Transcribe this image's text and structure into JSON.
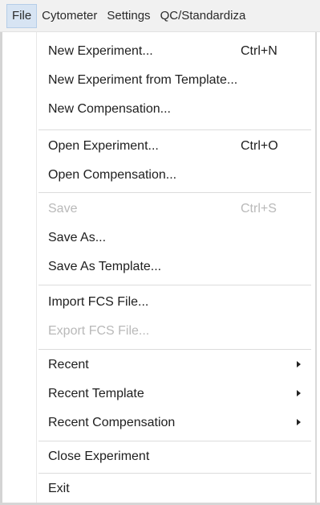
{
  "menubar": {
    "items": [
      "File",
      "Cytometer",
      "Settings",
      "QC/Standardiza"
    ]
  },
  "file_menu": {
    "items": [
      {
        "label": "New Experiment...",
        "shortcut": "Ctrl+N",
        "enabled": true
      },
      {
        "label": "New Experiment from Template...",
        "shortcut": "",
        "enabled": true
      },
      {
        "label": "New Compensation...",
        "shortcut": "",
        "enabled": true
      },
      {
        "label": "Open Experiment...",
        "shortcut": "Ctrl+O",
        "enabled": true
      },
      {
        "label": "Open Compensation...",
        "shortcut": "",
        "enabled": true
      },
      {
        "label": "Save",
        "shortcut": "Ctrl+S",
        "enabled": false
      },
      {
        "label": "Save As...",
        "shortcut": "",
        "enabled": true
      },
      {
        "label": "Save As Template...",
        "shortcut": "",
        "enabled": true
      },
      {
        "label": "Import FCS File...",
        "shortcut": "",
        "enabled": true
      },
      {
        "label": "Export FCS File...",
        "shortcut": "",
        "enabled": false
      },
      {
        "label": "Recent",
        "submenu": true,
        "enabled": true
      },
      {
        "label": "Recent Template",
        "submenu": true,
        "enabled": true
      },
      {
        "label": "Recent Compensation",
        "submenu": true,
        "enabled": true
      },
      {
        "label": "Close Experiment",
        "shortcut": "",
        "enabled": true
      },
      {
        "label": "Exit",
        "shortcut": "",
        "enabled": true
      }
    ]
  }
}
